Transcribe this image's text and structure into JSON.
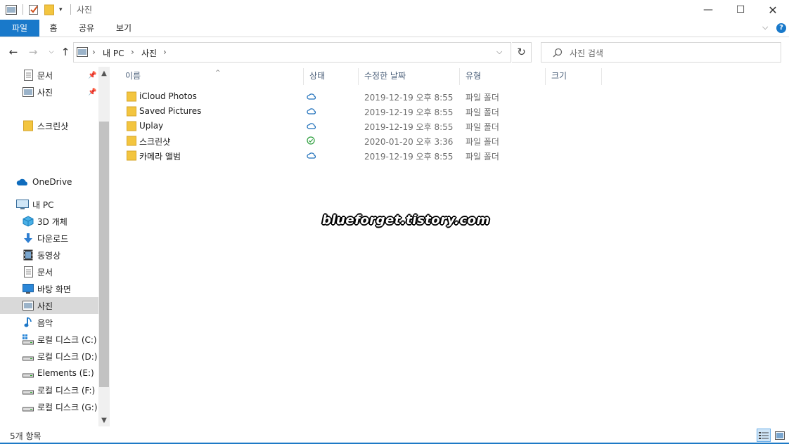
{
  "window": {
    "title": "사진",
    "minimize_icon": "minimize-icon",
    "maximize_icon": "maximize-icon",
    "close_icon": "close-icon"
  },
  "ribbon": {
    "tabs": [
      {
        "label": "파일",
        "active": true
      },
      {
        "label": "홈"
      },
      {
        "label": "공유"
      },
      {
        "label": "보기"
      }
    ]
  },
  "address": {
    "breadcrumb": [
      "내 PC",
      "사진"
    ],
    "search_placeholder": "사진 검색"
  },
  "nav": {
    "quick_access": [
      {
        "label": "문서",
        "icon": "documents-icon",
        "pinned": true
      },
      {
        "label": "사진",
        "icon": "pictures-icon",
        "pinned": true
      },
      {
        "label": "스크린샷",
        "icon": "folder-icon"
      }
    ],
    "onedrive": {
      "label": "OneDrive",
      "icon": "onedrive-icon"
    },
    "this_pc": {
      "label": "내 PC",
      "icon": "pc-icon"
    },
    "pc_items": [
      {
        "label": "3D 개체",
        "icon": "3d-objects-icon"
      },
      {
        "label": "다운로드",
        "icon": "downloads-icon"
      },
      {
        "label": "동영상",
        "icon": "videos-icon"
      },
      {
        "label": "문서",
        "icon": "documents-icon"
      },
      {
        "label": "바탕 화면",
        "icon": "desktop-icon"
      },
      {
        "label": "사진",
        "icon": "pictures-icon",
        "selected": true
      },
      {
        "label": "음악",
        "icon": "music-icon"
      },
      {
        "label": "로컬 디스크 (C:)",
        "icon": "system-drive-icon"
      },
      {
        "label": "로컬 디스크 (D:)",
        "icon": "drive-icon"
      },
      {
        "label": "Elements (E:)",
        "icon": "drive-icon"
      },
      {
        "label": "로컬 디스크 (F:)",
        "icon": "drive-icon"
      },
      {
        "label": "로컬 디스크 (G:)",
        "icon": "drive-icon"
      }
    ]
  },
  "columns": {
    "name": "이름",
    "status": "상태",
    "modified": "수정한 날짜",
    "type": "유형",
    "size": "크기"
  },
  "files": [
    {
      "name": "iCloud Photos",
      "status": "cloud",
      "modified": "2019-12-19 오후 8:55",
      "type": "파일 폴더"
    },
    {
      "name": "Saved Pictures",
      "status": "cloud",
      "modified": "2019-12-19 오후 8:55",
      "type": "파일 폴더"
    },
    {
      "name": "Uplay",
      "status": "cloud",
      "modified": "2019-12-19 오후 8:55",
      "type": "파일 폴더"
    },
    {
      "name": "스크린샷",
      "status": "synced",
      "modified": "2020-01-20 오후 3:36",
      "type": "파일 폴더"
    },
    {
      "name": "카메라 앨범",
      "status": "cloud",
      "modified": "2019-12-19 오후 8:55",
      "type": "파일 폴더"
    }
  ],
  "watermark": "blueforget.tistory.com",
  "statusbar": {
    "item_count": "5개 항목"
  },
  "colors": {
    "accent": "#1979ca",
    "folder": "#f3c53f",
    "cloud": "#1e6fba",
    "synced": "#2c9e3c",
    "selection": "#d9d9d9"
  }
}
